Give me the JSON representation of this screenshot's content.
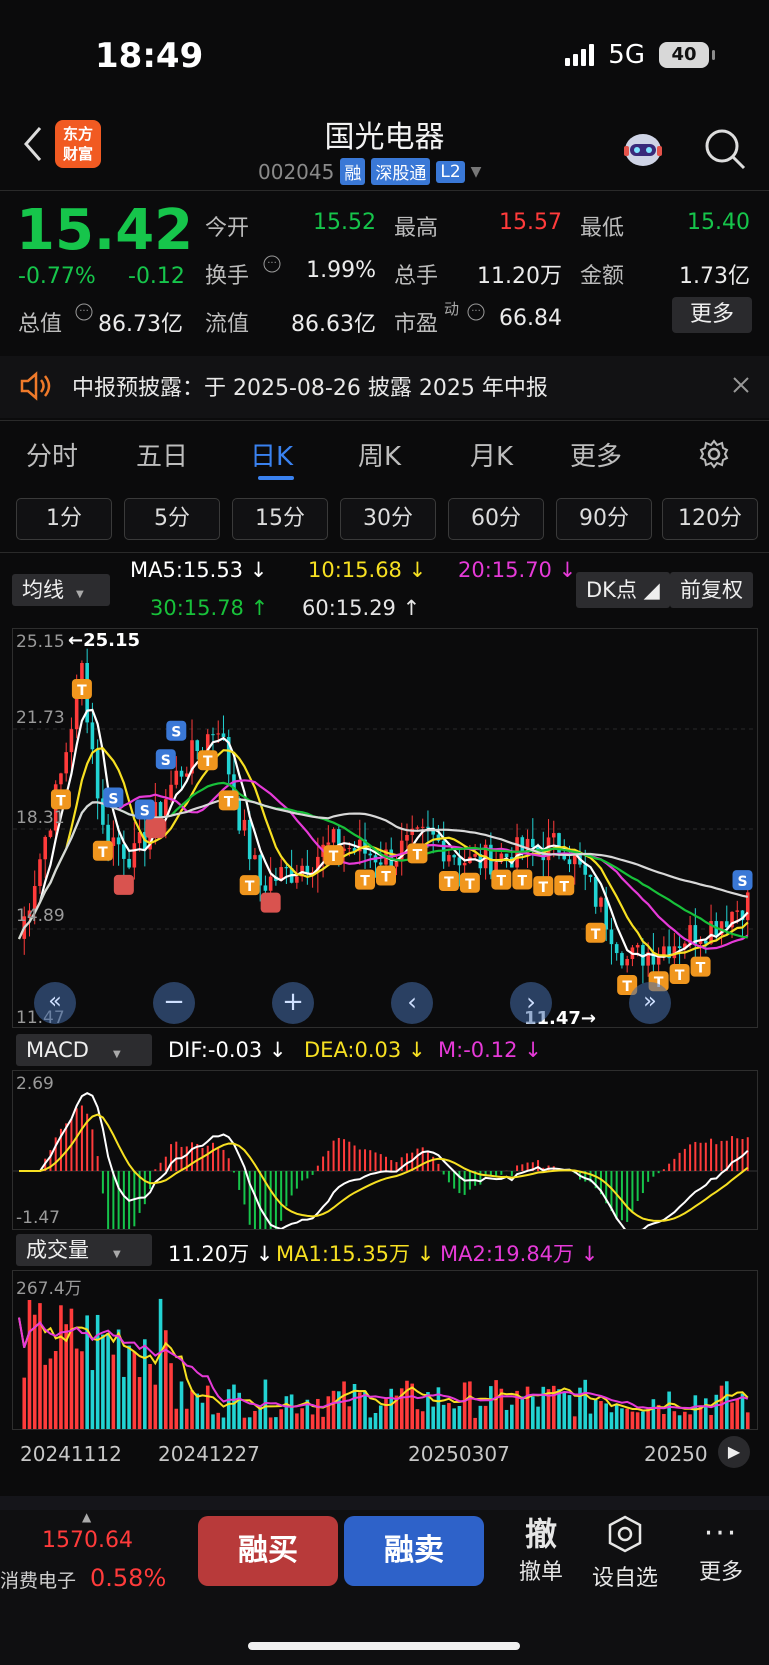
{
  "status": {
    "time": "18:49",
    "network": "5G",
    "battery": "40"
  },
  "header": {
    "logo_line1": "东方",
    "logo_line2": "财富",
    "title": "国光电器",
    "code": "002045",
    "tags": [
      "融",
      "深股通",
      "L2"
    ]
  },
  "quote": {
    "price": "15.42",
    "change_pct": "-0.77%",
    "change": "-0.12",
    "open_label": "今开",
    "open": "15.52",
    "high_label": "最高",
    "high": "15.57",
    "low_label": "最低",
    "low": "15.40",
    "turnover_label": "换手",
    "turnover": "1.99%",
    "volume_label": "总手",
    "volume": "11.20万",
    "amount_label": "金额",
    "amount": "1.73亿",
    "mktcap_label": "总值",
    "mktcap": "86.73亿",
    "float_label": "流值",
    "float": "86.63亿",
    "pe_label": "市盈",
    "pe_sup": "动",
    "pe": "66.84",
    "more": "更多"
  },
  "notice": {
    "text": "中报预披露：于 2025-08-26 披露 2025 年中报"
  },
  "tabs": [
    "分时",
    "五日",
    "日K",
    "周K",
    "月K",
    "更多"
  ],
  "periods": [
    "1分",
    "5分",
    "15分",
    "30分",
    "60分",
    "90分",
    "120分"
  ],
  "kline": {
    "indicator": "均线",
    "ma5": "MA5:15.53 ↓",
    "ma10": "10:15.68 ↓",
    "ma20": "20:15.70 ↓",
    "ma30": "30:15.78 ↑",
    "ma60": "60:15.29 ↑",
    "dk_btn": "DK点",
    "adj_btn": "前复权",
    "y_labels": [
      "25.15",
      "21.73",
      "18.31",
      "14.89",
      "11.47"
    ],
    "max_mark": "←25.15",
    "min_mark": "11.47→",
    "signals": {
      "buy": "B",
      "sell": "S",
      "t": "T"
    }
  },
  "macd": {
    "indicator": "MACD",
    "dif": "DIF:-0.03 ↓",
    "dea": "DEA:0.03 ↓",
    "m": "M:-0.12 ↓",
    "y_top": "2.69",
    "y_bottom": "-1.47"
  },
  "volume": {
    "indicator": "成交量",
    "vol": "11.20万 ↓",
    "ma1": "MA1:15.35万 ↓",
    "ma2": "MA2:19.84万 ↓",
    "y_top": "267.4万"
  },
  "dates": [
    "20241112",
    "20241227",
    "20250307",
    "20250"
  ],
  "bottom": {
    "index_price": "1570.64",
    "index_name": "消费电子",
    "index_change": "0.58%",
    "buy": "融买",
    "sell": "融卖",
    "actions": [
      {
        "icon": "撤",
        "label": "撤单"
      },
      {
        "icon": "settings",
        "label": "设自选"
      },
      {
        "icon": "more",
        "label": "更多"
      }
    ]
  },
  "colors": {
    "up": "#ff3b3b",
    "down": "#16c54b",
    "accent": "#3a82f0",
    "ma5": "#ffffff",
    "ma10": "#f7e022",
    "ma20": "#e63ad8",
    "ma30": "#18c13a",
    "ma60": "#d8d8d8"
  }
}
